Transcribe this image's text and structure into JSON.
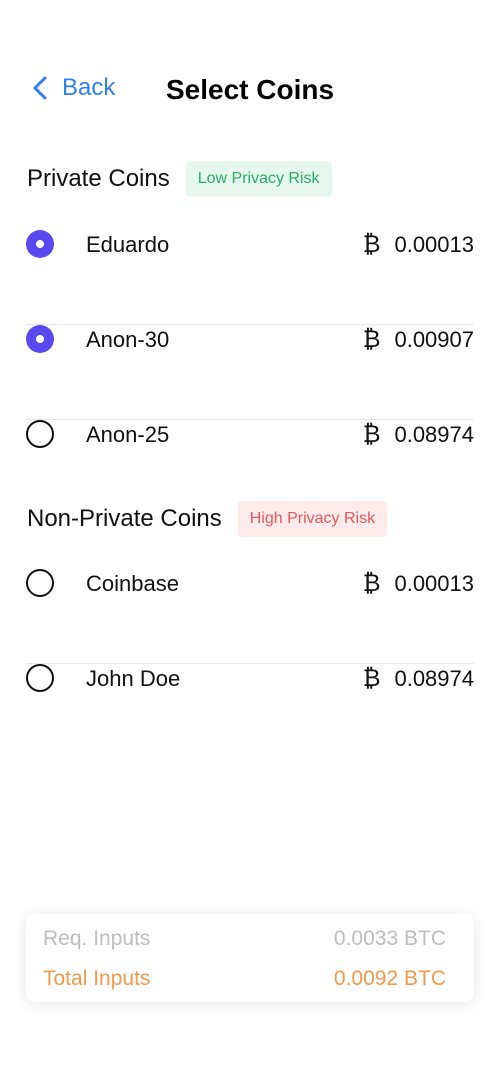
{
  "header": {
    "back_label": "Back",
    "title": "Select Coins"
  },
  "private_section": {
    "title": "Private Coins",
    "badge": "Low Privacy Risk",
    "coins": [
      {
        "name": "Eduardo",
        "symbol": "₿",
        "amount": "0.00013",
        "selected": true
      },
      {
        "name": "Anon-30",
        "symbol": "₿",
        "amount": "0.00907",
        "selected": true
      },
      {
        "name": "Anon-25",
        "symbol": "₿",
        "amount": "0.08974",
        "selected": false
      }
    ]
  },
  "non_private_section": {
    "title": "Non-Private Coins",
    "badge": "High Privacy Risk",
    "coins": [
      {
        "name": "Coinbase",
        "symbol": "₿",
        "amount": "0.00013",
        "selected": false
      },
      {
        "name": "John Doe",
        "symbol": "₿",
        "amount": "0.08974",
        "selected": false
      }
    ]
  },
  "summary": {
    "req_label": "Req. Inputs",
    "req_value": "0.0033 BTC",
    "total_label": "Total Inputs",
    "total_value": "0.0092 BTC"
  },
  "colors": {
    "accent": "#2F80ED",
    "radio_selected": "#5B48F0",
    "low_risk": "#27AE60",
    "high_risk": "#E05A5A",
    "total": "#F2994A"
  },
  "icons": {
    "back": "chevron-left-icon",
    "currency": "bitcoin-icon"
  }
}
